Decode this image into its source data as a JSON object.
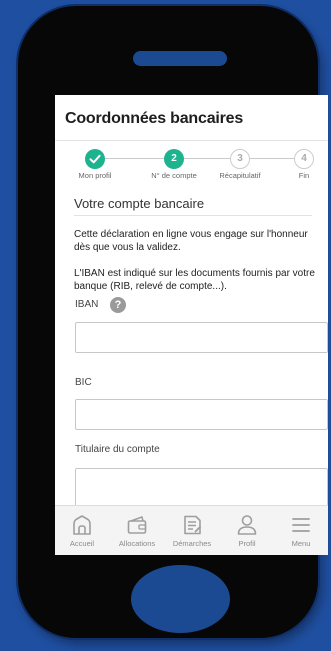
{
  "app": {
    "title": "Coordonnées bancaires"
  },
  "stepper": {
    "steps": [
      {
        "number": "",
        "label": "Mon profil",
        "status": "done",
        "icon": "check-icon"
      },
      {
        "number": "2",
        "label": "N° de compte",
        "status": "active"
      },
      {
        "number": "3",
        "label": "Récapitulatif",
        "status": "todo"
      },
      {
        "number": "4",
        "label": "Fin",
        "status": "todo"
      }
    ]
  },
  "form": {
    "section_title": "Votre compte bancaire",
    "declaration": "Cette déclaration en ligne vous engage sur l'honneur dès que vous la validez.",
    "iban_info": "L'IBAN est indiqué sur les documents fournis par votre banque (RIB, relevé de compte...).",
    "iban_label": "IBAN",
    "iban_help_icon": "?",
    "iban_value": "",
    "bic_label": "BIC",
    "bic_value": "",
    "holder_label": "Titulaire du compte",
    "holder_value": ""
  },
  "tabbar": {
    "tabs": [
      {
        "label": "Accueil",
        "icon": "home-icon"
      },
      {
        "label": "Allocations",
        "icon": "wallet-icon"
      },
      {
        "label": "Démarches",
        "icon": "document-icon"
      },
      {
        "label": "Profil",
        "icon": "user-icon"
      },
      {
        "label": "Menu",
        "icon": "menu-icon"
      }
    ]
  },
  "colors": {
    "background": "#1f4fa0",
    "phone_body": "#070707",
    "phone_accents": "#1b4a92",
    "step_active": "#1db38e",
    "tab_icon": "#9e9e9e"
  }
}
